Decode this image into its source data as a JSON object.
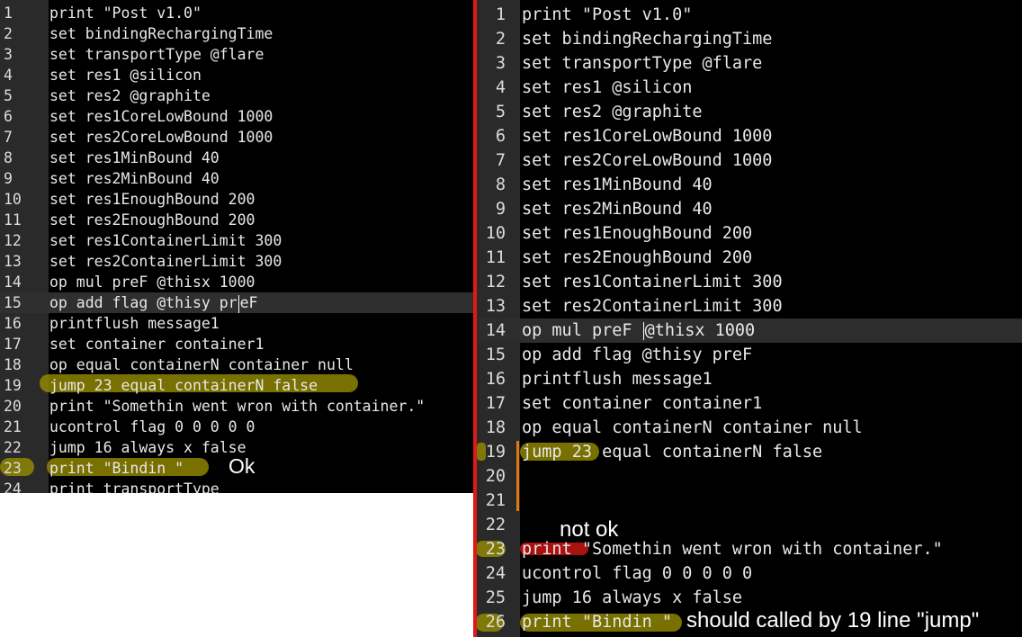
{
  "left_panel": {
    "lines": [
      {
        "n": "1",
        "code": "print \"Post v1.0\""
      },
      {
        "n": "2",
        "code": "set bindingRechargingTime"
      },
      {
        "n": "3",
        "code": "set transportType @flare"
      },
      {
        "n": "4",
        "code": "set res1 @silicon"
      },
      {
        "n": "5",
        "code": "set res2 @graphite"
      },
      {
        "n": "6",
        "code": "set res1CoreLowBound 1000"
      },
      {
        "n": "7",
        "code": "set res2CoreLowBound 1000"
      },
      {
        "n": "8",
        "code": "set res1MinBound 40"
      },
      {
        "n": "9",
        "code": "set res2MinBound 40"
      },
      {
        "n": "10",
        "code": "set res1EnoughBound 200"
      },
      {
        "n": "11",
        "code": "set res2EnoughBound 200"
      },
      {
        "n": "12",
        "code": "set res1ContainerLimit 300"
      },
      {
        "n": "13",
        "code": "set res2ContainerLimit 300"
      },
      {
        "n": "14",
        "code": "op mul preF @thisx 1000"
      },
      {
        "n": "15",
        "code_before_caret": "op add flag @thisy pr",
        "code_after_caret": "eF"
      },
      {
        "n": "16",
        "code": "printflush message1"
      },
      {
        "n": "17",
        "code": "set container container1"
      },
      {
        "n": "18",
        "code": "op equal containerN container null"
      },
      {
        "n": "19",
        "code": "jump 23 equal containerN false"
      },
      {
        "n": "20",
        "code": "print \"Somethin went wron with container.\""
      },
      {
        "n": "21",
        "code": "ucontrol flag 0 0 0 0 0"
      },
      {
        "n": "22",
        "code": "jump 16 always x false"
      },
      {
        "n": "23",
        "code": "print \"Bindin \""
      },
      {
        "n": "24",
        "code": "print transportType"
      }
    ],
    "annotation_ok": "Ok"
  },
  "right_panel": {
    "lines": [
      {
        "n": "1",
        "code": "print \"Post v1.0\""
      },
      {
        "n": "2",
        "code": "set bindingRechargingTime"
      },
      {
        "n": "3",
        "code": "set transportType @flare"
      },
      {
        "n": "4",
        "code": "set res1 @silicon"
      },
      {
        "n": "5",
        "code": "set res2 @graphite"
      },
      {
        "n": "6",
        "code": "set res1CoreLowBound 1000"
      },
      {
        "n": "7",
        "code": "set res2CoreLowBound 1000"
      },
      {
        "n": "8",
        "code": "set res1MinBound 40"
      },
      {
        "n": "9",
        "code": "set res2MinBound 40"
      },
      {
        "n": "10",
        "code": "set res1EnoughBound 200"
      },
      {
        "n": "11",
        "code": "set res2EnoughBound 200"
      },
      {
        "n": "12",
        "code": "set res1ContainerLimit 300"
      },
      {
        "n": "13",
        "code": "set res2ContainerLimit 300"
      },
      {
        "n": "14",
        "code_before_caret": "op mul preF ",
        "code_after_caret": "@thisx 1000"
      },
      {
        "n": "15",
        "code": "op add flag @thisy preF"
      },
      {
        "n": "16",
        "code": "printflush message1"
      },
      {
        "n": "17",
        "code": "set container container1"
      },
      {
        "n": "18",
        "code": "op equal containerN container null"
      },
      {
        "n": "19",
        "code": "jump 23 equal containerN false"
      },
      {
        "n": "20",
        "code": ""
      },
      {
        "n": "21",
        "code": ""
      },
      {
        "n": "22",
        "code": ""
      },
      {
        "n": "23",
        "code": "print \"Somethin went wron with container.\""
      },
      {
        "n": "24",
        "code": "ucontrol flag 0 0 0 0 0"
      },
      {
        "n": "25",
        "code": "jump 16 always x false"
      },
      {
        "n": "26",
        "code": "print \"Bindin \""
      }
    ],
    "annotation_not_ok": "not ok",
    "annotation_should": "should called by 19 line \"jump\""
  },
  "colors": {
    "editor_bg": "#000000",
    "gutter_bg": "#2a2a2a",
    "current_line_bg": "#2f2f2f",
    "divider": "#e01818",
    "highlight_olive": "#968c00",
    "highlight_red": "#c81414",
    "change_marker": "#e07a10"
  }
}
